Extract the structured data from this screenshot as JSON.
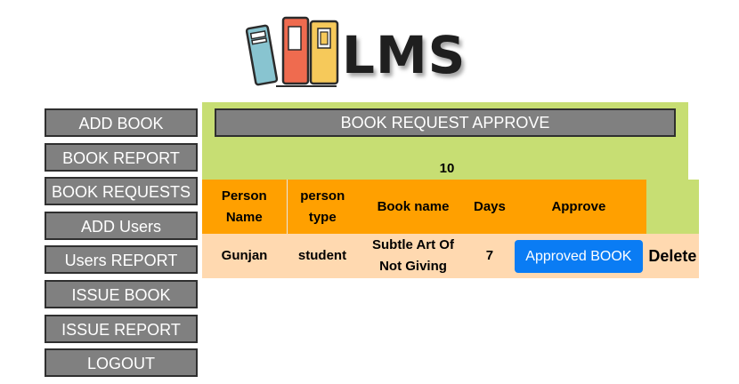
{
  "logo": {
    "text": "LMS",
    "icon": "books-icon",
    "colors": {
      "book1": "#88c4d0",
      "book2": "#ef6b4f",
      "book3": "#f6c95a",
      "outline": "#2b2b2b"
    }
  },
  "sidebar": {
    "items": [
      {
        "label": "ADD BOOK"
      },
      {
        "label": "BOOK REPORT"
      },
      {
        "label": "BOOK REQUESTS"
      },
      {
        "label": "ADD Users"
      },
      {
        "label": "Users REPORT"
      },
      {
        "label": "ISSUE BOOK"
      },
      {
        "label": "ISSUE REPORT"
      },
      {
        "label": "LOGOUT"
      }
    ]
  },
  "main": {
    "title": "BOOK REQUEST APPROVE",
    "count": "10",
    "table": {
      "headers": [
        "Person Name",
        "person type",
        "Book name",
        "Days",
        "Approve"
      ],
      "rows": [
        {
          "person_name": "Gunjan",
          "person_type": "student",
          "book_name": "Subtle Art Of Not Giving",
          "days": "7",
          "approve_label": "Approved BOOK",
          "delete_label": "Delete"
        }
      ]
    }
  },
  "colors": {
    "panel_bg": "#c7de73",
    "header_bg": "#ffa000",
    "row_bg": "#ffd9b0",
    "button_blue": "#0a7cf4",
    "sidebar_btn": "#808080"
  }
}
